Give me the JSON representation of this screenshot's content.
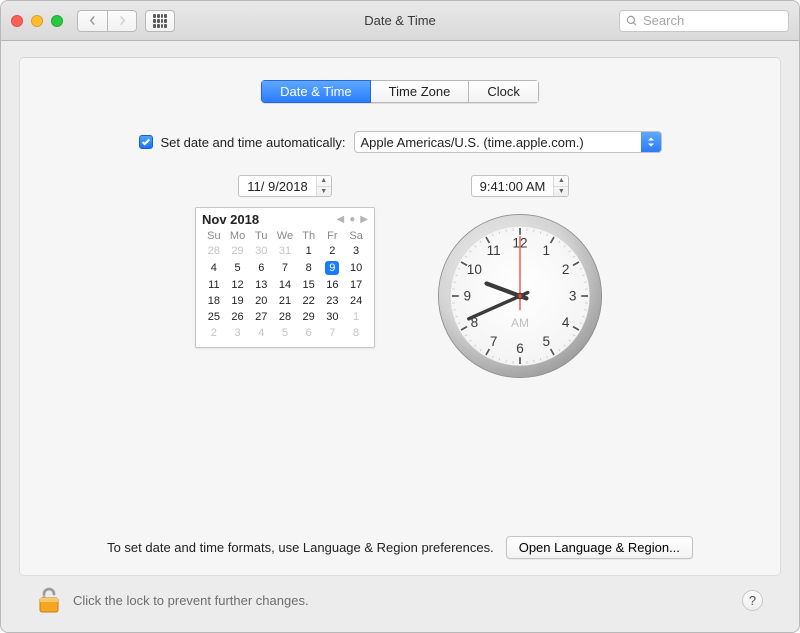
{
  "window": {
    "title": "Date & Time"
  },
  "search": {
    "placeholder": "Search"
  },
  "tabs": {
    "date_time": "Date & Time",
    "time_zone": "Time Zone",
    "clock": "Clock"
  },
  "auto": {
    "label": "Set date and time automatically:",
    "server": "Apple Americas/U.S. (time.apple.com.)"
  },
  "date_field": "11/  9/2018",
  "time_field": "9:41:00 AM",
  "calendar": {
    "month_label": "Nov 2018",
    "weekdays": [
      "Su",
      "Mo",
      "Tu",
      "We",
      "Th",
      "Fr",
      "Sa"
    ],
    "rows": [
      [
        {
          "d": "28",
          "o": true
        },
        {
          "d": "29",
          "o": true
        },
        {
          "d": "30",
          "o": true
        },
        {
          "d": "31",
          "o": true
        },
        {
          "d": "1"
        },
        {
          "d": "2"
        },
        {
          "d": "3"
        }
      ],
      [
        {
          "d": "4"
        },
        {
          "d": "5"
        },
        {
          "d": "6"
        },
        {
          "d": "7"
        },
        {
          "d": "8"
        },
        {
          "d": "9",
          "today": true
        },
        {
          "d": "10"
        }
      ],
      [
        {
          "d": "11"
        },
        {
          "d": "12"
        },
        {
          "d": "13"
        },
        {
          "d": "14"
        },
        {
          "d": "15"
        },
        {
          "d": "16"
        },
        {
          "d": "17"
        }
      ],
      [
        {
          "d": "18"
        },
        {
          "d": "19"
        },
        {
          "d": "20"
        },
        {
          "d": "21"
        },
        {
          "d": "22"
        },
        {
          "d": "23"
        },
        {
          "d": "24"
        }
      ],
      [
        {
          "d": "25"
        },
        {
          "d": "26"
        },
        {
          "d": "27"
        },
        {
          "d": "28"
        },
        {
          "d": "29"
        },
        {
          "d": "30"
        },
        {
          "d": "1",
          "o": true
        }
      ],
      [
        {
          "d": "2",
          "o": true
        },
        {
          "d": "3",
          "o": true
        },
        {
          "d": "4",
          "o": true
        },
        {
          "d": "5",
          "o": true
        },
        {
          "d": "6",
          "o": true
        },
        {
          "d": "7",
          "o": true
        },
        {
          "d": "8",
          "o": true
        }
      ]
    ]
  },
  "clock_face": {
    "numbers": [
      "12",
      "1",
      "2",
      "3",
      "4",
      "5",
      "6",
      "7",
      "8",
      "9",
      "10",
      "11"
    ],
    "ampm": "AM",
    "hour": 9,
    "minute": 41,
    "second": 0
  },
  "hint": {
    "text": "To set date and time formats, use Language & Region preferences.",
    "button": "Open Language & Region..."
  },
  "footer": {
    "lock_msg": "Click the lock to prevent further changes.",
    "help": "?"
  }
}
